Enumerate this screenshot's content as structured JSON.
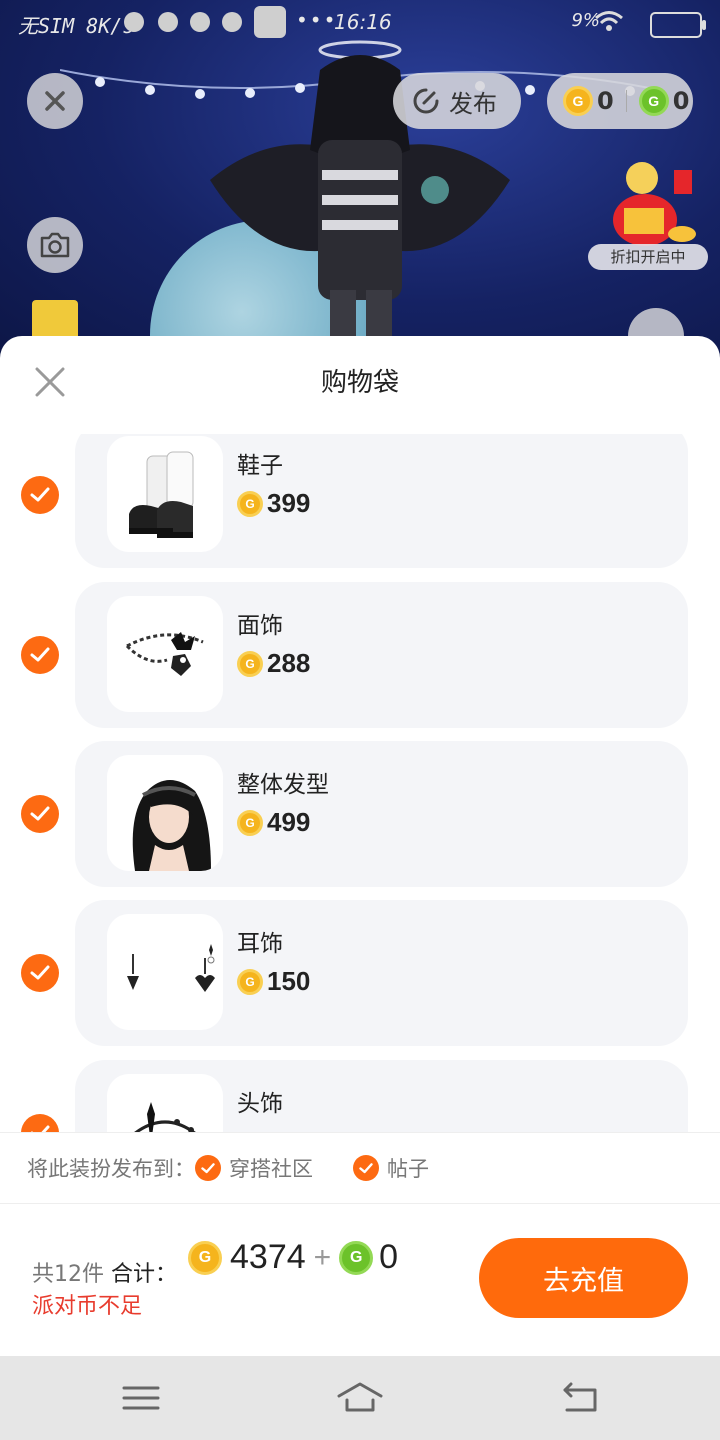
{
  "status_bar": {
    "carrier": "无SIM 8K/s",
    "time": "16:16",
    "battery": "9%"
  },
  "top": {
    "publish_label": "发布",
    "gold_balance": "0",
    "green_balance": "0",
    "promo_label": "折扣开启中"
  },
  "sheet": {
    "title": "购物袋",
    "items": [
      {
        "name": "鞋子",
        "price": "399",
        "icon": "shoes-icon"
      },
      {
        "name": "面饰",
        "price": "288",
        "icon": "face-accessory-icon"
      },
      {
        "name": "整体发型",
        "price": "499",
        "icon": "hairstyle-icon"
      },
      {
        "name": "耳饰",
        "price": "150",
        "icon": "earring-icon"
      },
      {
        "name": "头饰",
        "price": "",
        "icon": "headwear-icon"
      }
    ],
    "publish": {
      "prompt": "将此装扮发布到：",
      "option1": "穿搭社区",
      "option2": "帖子"
    },
    "footer": {
      "count_text": "共12件",
      "total_label": "合计：",
      "gold_total": "4374",
      "plus": "+",
      "green_total": "0",
      "warning": "派对币不足",
      "recharge_label": "去充值"
    }
  },
  "colors": {
    "accent": "#ff6a0c",
    "warning": "#e83c2e",
    "gold_coin": "#f5b41d",
    "green_coin": "#6cc22a"
  }
}
